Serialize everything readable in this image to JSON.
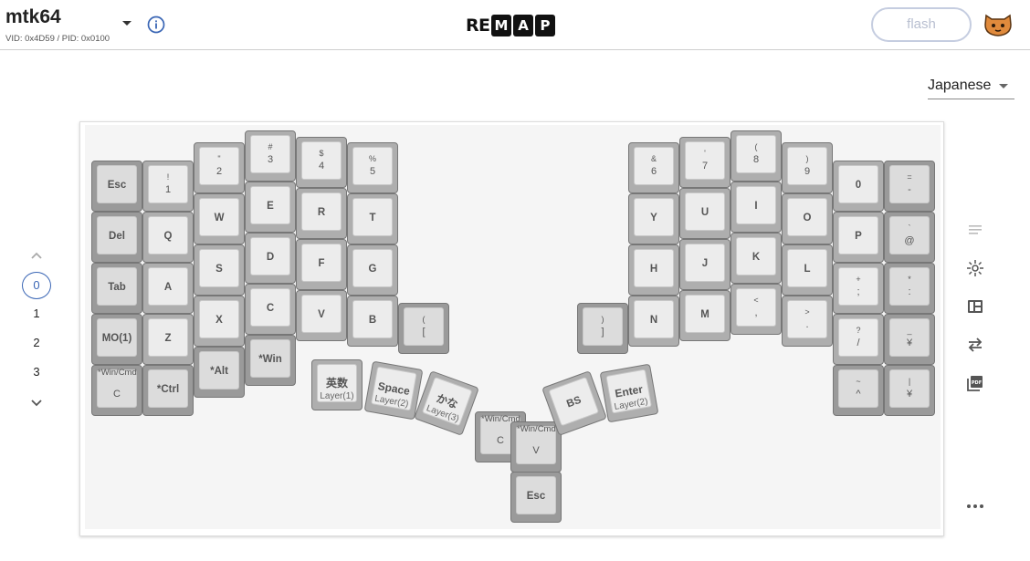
{
  "header": {
    "keyboard_name": "mtk64",
    "ids": "VID: 0x4D59 / PID: 0x0100",
    "logo": [
      "R",
      "E",
      "M",
      "A",
      "P"
    ],
    "flash_label": "flash"
  },
  "language": {
    "selected": "Japanese"
  },
  "layers": {
    "items": [
      "0",
      "1",
      "2",
      "3"
    ],
    "active": "0"
  },
  "keys": {
    "esc": {
      "main": "Esc"
    },
    "k1": {
      "top": "!",
      "bot": "1"
    },
    "k2": {
      "top": "\"",
      "bot": "2"
    },
    "k3": {
      "top": "#",
      "bot": "3"
    },
    "k4": {
      "top": "$",
      "bot": "4"
    },
    "k5": {
      "top": "%",
      "bot": "5"
    },
    "k6": {
      "top": "&",
      "bot": "6"
    },
    "k7": {
      "top": "'",
      "bot": "7"
    },
    "k8": {
      "top": "(",
      "bot": "8"
    },
    "k9": {
      "top": ")",
      "bot": "9"
    },
    "k0": {
      "main": "0"
    },
    "kminus": {
      "top": "=",
      "bot": "-"
    },
    "del": {
      "main": "Del"
    },
    "q": {
      "main": "Q"
    },
    "w": {
      "main": "W"
    },
    "e": {
      "main": "E"
    },
    "r": {
      "main": "R"
    },
    "t": {
      "main": "T"
    },
    "y": {
      "main": "Y"
    },
    "u": {
      "main": "U"
    },
    "i": {
      "main": "I"
    },
    "o": {
      "main": "O"
    },
    "p": {
      "main": "P"
    },
    "at": {
      "top": "`",
      "bot": "@"
    },
    "tab": {
      "main": "Tab"
    },
    "a": {
      "main": "A"
    },
    "s": {
      "main": "S"
    },
    "d": {
      "main": "D"
    },
    "f": {
      "main": "F"
    },
    "g": {
      "main": "G"
    },
    "h": {
      "main": "H"
    },
    "j": {
      "main": "J"
    },
    "k": {
      "main": "K"
    },
    "l": {
      "main": "L"
    },
    "semi": {
      "top": "+",
      "bot": ";"
    },
    "colon": {
      "top": "*",
      "bot": ":"
    },
    "mo1": {
      "main": "MO(1)"
    },
    "z": {
      "main": "Z"
    },
    "x": {
      "main": "X"
    },
    "c": {
      "main": "C"
    },
    "v": {
      "main": "V"
    },
    "b": {
      "main": "B"
    },
    "lbrk": {
      "top": "(",
      "bot": "["
    },
    "rbrk": {
      "top": ")",
      "bot": "]"
    },
    "n": {
      "main": "N"
    },
    "m": {
      "main": "M"
    },
    "comma": {
      "top": "<",
      "bot": ","
    },
    "period": {
      "top": ">",
      "bot": "."
    },
    "slash": {
      "top": "?",
      "bot": "/"
    },
    "yen": {
      "top": "_",
      "bot": "¥"
    },
    "wincmd_c": {
      "small": "*Win/Cmd",
      "main": "C"
    },
    "ctrl": {
      "main": "*Ctrl"
    },
    "alt": {
      "main": "*Alt"
    },
    "win": {
      "main": "*Win"
    },
    "eisu": {
      "main": "英数",
      "layer": "Layer(1)"
    },
    "space": {
      "main": "Space",
      "layer": "Layer(2)"
    },
    "kana": {
      "main": "かな",
      "layer": "Layer(3)"
    },
    "wincmd_c2": {
      "small": "*Win/Cmd",
      "main": "C"
    },
    "wincmd_v": {
      "small": "*Win/Cmd",
      "main": "V"
    },
    "bs": {
      "main": "BS"
    },
    "enter": {
      "main": "Enter",
      "layer": "Layer(2)"
    },
    "esc2": {
      "main": "Esc"
    },
    "caret": {
      "top": "~",
      "bot": "^"
    },
    "yen2": {
      "top": "|",
      "bot": "¥"
    }
  }
}
